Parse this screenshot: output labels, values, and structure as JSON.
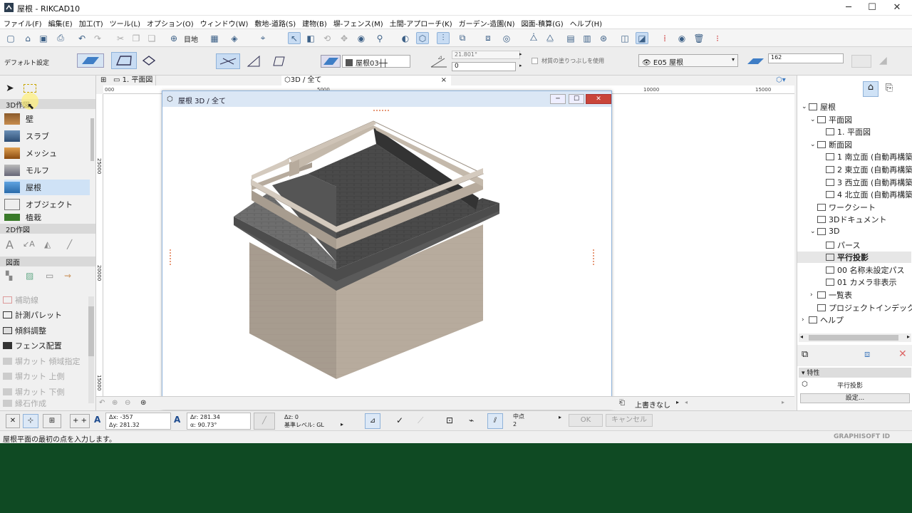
{
  "window": {
    "title": "屋根 - RIKCAD10",
    "minimize": "─",
    "maximize": "☐",
    "close": "✕"
  },
  "menu": [
    "ファイル(F)",
    "編集(E)",
    "加工(T)",
    "ツール(L)",
    "オプション(O)",
    "ウィンドウ(W)",
    "敷地-道路(S)",
    "建物(B)",
    "塀-フェンス(M)",
    "土間-アプローチ(K)",
    "ガーデン-造園(N)",
    "図面-積算(G)",
    "ヘルプ(H)"
  ],
  "toolbar": {
    "site_label": "目地"
  },
  "infobox": {
    "default_setting": "デフォルト設定",
    "layer": "屋根03┼┼",
    "angle_value": "21.801°",
    "thickness_value": "0",
    "material_check_label": "材質の塗りつぶしを使用",
    "favorite": "E05 屋根",
    "scale_value": "162"
  },
  "toolbox": {
    "section_3d": "3D作図",
    "tools_3d": [
      "壁",
      "スラブ",
      "メッシュ",
      "モルフ",
      "屋根",
      "オブジェクト",
      "植栽"
    ],
    "section_2d": "2D作図",
    "section_drawing": "図面",
    "palettes": [
      {
        "label": "補助線",
        "enabled": false
      },
      {
        "label": "計測パレット",
        "enabled": true
      },
      {
        "label": "傾斜調整",
        "enabled": true
      },
      {
        "label": "フェンス配置",
        "enabled": true
      },
      {
        "label": "塀カット 傾域指定",
        "enabled": false
      },
      {
        "label": "塀カット 上側",
        "enabled": false
      },
      {
        "label": "塀カット 下側",
        "enabled": false
      },
      {
        "label": "縁石作成",
        "enabled": false
      }
    ]
  },
  "tabs": {
    "plan": "1. 平面図",
    "view3d": "3D / 全て",
    "close": "×"
  },
  "ruler": {
    "t0": "000",
    "t1": "5000",
    "t2": "10000",
    "t3": "15000",
    "v1": "25000",
    "v2": "20000",
    "v3": "15000"
  },
  "window3d": {
    "title": "屋根 3D / 全て"
  },
  "viewstatus": {
    "overwrite": "上書きなし"
  },
  "navigator": {
    "items": [
      {
        "label": "屋根",
        "level": 0,
        "expand": "⌄"
      },
      {
        "label": "平面図",
        "level": 1,
        "expand": "⌄"
      },
      {
        "label": "1. 平面図",
        "level": 2,
        "expand": ""
      },
      {
        "label": "断面図",
        "level": 1,
        "expand": "⌄"
      },
      {
        "label": "1 南立面 (自動再構築モ",
        "level": 2,
        "expand": ""
      },
      {
        "label": "2 東立面 (自動再構築モ",
        "level": 2,
        "expand": ""
      },
      {
        "label": "3 西立面 (自動再構築モ",
        "level": 2,
        "expand": ""
      },
      {
        "label": "4 北立面 (自動再構築モ",
        "level": 2,
        "expand": ""
      },
      {
        "label": "ワークシート",
        "level": 1,
        "expand": ""
      },
      {
        "label": "3Dドキュメント",
        "level": 1,
        "expand": ""
      },
      {
        "label": "3D",
        "level": 1,
        "expand": "⌄"
      },
      {
        "label": "パース",
        "level": 2,
        "expand": ""
      },
      {
        "label": "平行投影",
        "level": 2,
        "expand": "",
        "selected": true
      },
      {
        "label": "00 名称未設定パス",
        "level": 2,
        "expand": ""
      },
      {
        "label": "01 カメラ非表示",
        "level": 2,
        "expand": ""
      },
      {
        "label": "一覧表",
        "level": 1,
        "expand": "›"
      },
      {
        "label": "プロジェクトインデックス",
        "level": 1,
        "expand": ""
      },
      {
        "label": "ヘルプ",
        "level": 0,
        "expand": "›"
      }
    ],
    "properties_title": "特性",
    "properties_value": "平行投影",
    "settings_button": "設定..."
  },
  "coords": {
    "dx_label": "Δx: -357",
    "dy_label": "Δy: 281.32",
    "dr_label": "Δr: 281.34",
    "angle_label": "α: 90.73°",
    "dz_label": "Δz: 0",
    "level_label": "基準レベル: GL",
    "snap_label": "中点",
    "snap_value": "2",
    "ok": "OK",
    "cancel": "キャンセル"
  },
  "status": {
    "message": "屋根平面の最初の点を入力します。",
    "brand": "GRAPHISOFT ID"
  }
}
